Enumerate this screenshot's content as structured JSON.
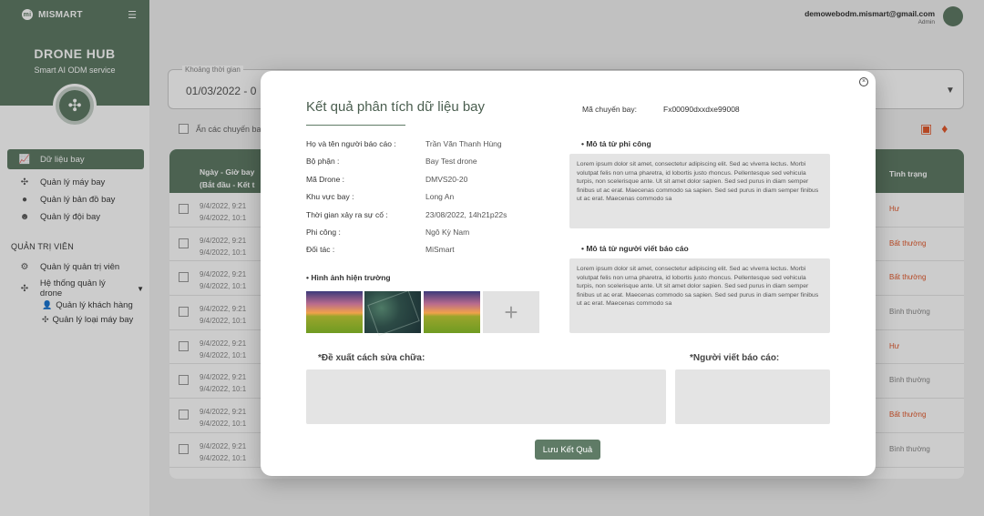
{
  "sidebar": {
    "brand": "MISMART",
    "brand_mark": "mi",
    "menu_icon": "menu-collapse-icon",
    "hub_title": "DRONE HUB",
    "hub_subtitle": "Smart AI ODM service",
    "hub_logo_icon": "drone-icon",
    "items": [
      {
        "label": "Dữ liệu bay",
        "icon": "chart-icon",
        "active": true
      },
      {
        "label": "Quản lý máy bay",
        "icon": "drone-icon"
      },
      {
        "label": "Quản lý bản đồ bay",
        "icon": "map-pin-icon"
      },
      {
        "label": "Quản lý đội bay",
        "icon": "team-icon"
      }
    ],
    "admin_section": "QUẢN TRỊ VIÊN",
    "admin_items": [
      {
        "label": "Quản lý quản trị viên",
        "icon": "user-admin-icon"
      },
      {
        "label": "Hệ thống quản lý drone",
        "icon": "drone-icon"
      }
    ],
    "sub_items": [
      {
        "label": "Quản lý khách hàng",
        "icon": "user-icon"
      },
      {
        "label": "Quản lý loại máy bay",
        "icon": "drone-icon"
      }
    ]
  },
  "user": {
    "email": "demowebodm.mismart@gmail.com",
    "role": "Admin"
  },
  "background": {
    "filter_label": "Khoảng thời gian",
    "filter_value": "01/03/2022 - 0",
    "check_label": "Ẩn các chuyến bay",
    "table_head_date": "Ngày - Giờ bay (Bắt đầu - Kết t",
    "table_head_status": "Tình trạng",
    "rows": [
      {
        "date": "9/4/2022, 9:21 9/4/2022, 10:1",
        "status": "Hư"
      },
      {
        "date": "9/4/2022, 9:21 9/4/2022, 10:1",
        "status": "Bất thường"
      },
      {
        "date": "9/4/2022, 9:21 9/4/2022, 10:1",
        "status": "Bất thường"
      },
      {
        "date": "9/4/2022, 9:21 9/4/2022, 10:1",
        "status": "Bình thường"
      },
      {
        "date": "9/4/2022, 9:21 9/4/2022, 10:1",
        "status": "Hư"
      },
      {
        "date": "9/4/2022, 9:21 9/4/2022, 10:1",
        "status": "Bình thường"
      },
      {
        "date": "9/4/2022, 9:21 9/4/2022, 10:1",
        "status": "Bất thường"
      },
      {
        "date": "9/4/2022, 9:21 9/4/2022, 10:1",
        "status": "Bình thường"
      }
    ]
  },
  "modal": {
    "title": "Kết quả phân tích dữ liệu bay",
    "flight_code_label": "Mã chuyến bay:",
    "flight_code_value": "Fx00090dxxdxe99008",
    "fields": [
      {
        "label": "Họ và tên người báo cáo :",
        "value": "Trần Văn Thanh Hùng"
      },
      {
        "label": "Bộ phận :",
        "value": "Bay Test drone"
      },
      {
        "label": "Mã Drone :",
        "value": "DMVS20-20"
      },
      {
        "label": "Khu vực bay :",
        "value": "Long An"
      },
      {
        "label": "Thời gian xảy ra sự cố :",
        "value": "23/08/2022, 14h21p22s"
      },
      {
        "label": "Phi công :",
        "value": "Ngô Kỳ Nam"
      },
      {
        "label": "Đối tác :",
        "value": "MiSmart"
      }
    ],
    "images_title": "• Hình ảnh hiện trường",
    "add_image_symbol": "+",
    "pilot_desc_title": "• Mô tả từ phi công",
    "pilot_desc": "Lorem ipsum dolor sit amet, consectetur adipiscing elit. Sed ac viverra lectus. Morbi volutpat felis non urna pharetra, id lobortis justo rhoncus. Pellentesque sed vehicula turpis, non scelerisque ante. Ut sit amet dolor sapien. Sed sed purus in diam semper finibus ut ac erat. Maecenas commodo sa  sapien. Sed sed purus in diam semper finibus ut ac erat. Maecenas commodo sa",
    "reporter_desc_title": "• Mô tả từ người viết báo cáo",
    "reporter_desc": "Lorem ipsum dolor sit amet, consectetur adipiscing elit. Sed ac viverra lectus. Morbi volutpat felis non urna pharetra, id lobortis justo rhoncus. Pellentesque sed vehicula turpis, non scelerisque ante. Ut sit amet dolor sapien. Sed sed purus in diam semper finibus ut ac erat. Maecenas commodo sa  sapien. Sed sed purus in diam semper finibus ut ac erat. Maecenas commodo sa",
    "suggest_label": "*Đề xuất cách sửa chữa:",
    "writer_label": "*Người viết báo cáo:",
    "save_label": "Lưu Kết Quả",
    "close_symbol": "×"
  },
  "colors": {
    "primary": "#5f7b66",
    "accent_alert": "#e3592c"
  }
}
